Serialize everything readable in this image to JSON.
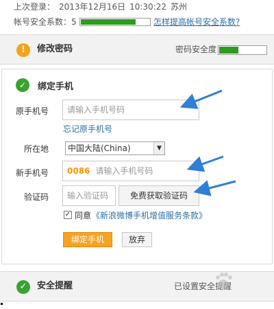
{
  "header": {
    "last_login_label": "上次登录：",
    "last_login_date": "2013年12月16日",
    "last_login_time": "10:30:22",
    "last_login_place": "苏州",
    "security_score_label": "帐号安全系数：5",
    "security_score_fraction": 0.78,
    "improve_link": "怎样提高帐号安全系数?"
  },
  "password_panel": {
    "title": "修改密码",
    "icon": "exclamation-icon",
    "strength_label": "密码安全度",
    "strength_fraction": 0.4
  },
  "bind_panel": {
    "title": "绑定手机",
    "icon": "checkmark-icon",
    "original_phone_label": "原手机号",
    "original_phone_placeholder": "请输入手机号码",
    "forgot_link": "忘记原手机号",
    "location_label": "所在地",
    "location_value": "中国大陆(China)",
    "new_phone_label": "新手机号",
    "country_code": "0086",
    "new_phone_placeholder": "请输入手机号码",
    "code_label": "验证码",
    "code_placeholder": "输入验证码",
    "get_code_button": "免费获取验证码",
    "agree_label": "同意",
    "terms_link": "《新浪微博手机增值服务条款》",
    "bind_button": "绑定手机",
    "cancel_button": "放弃"
  },
  "security_panel": {
    "title": "安全提醒",
    "icon": "checkmark-icon",
    "status": "已设置安全提醒"
  },
  "colors": {
    "green": "#3aa233",
    "orange": "#f7a21b",
    "link": "#2b6ea6",
    "annotation_arrow": "#2f7fd6"
  }
}
